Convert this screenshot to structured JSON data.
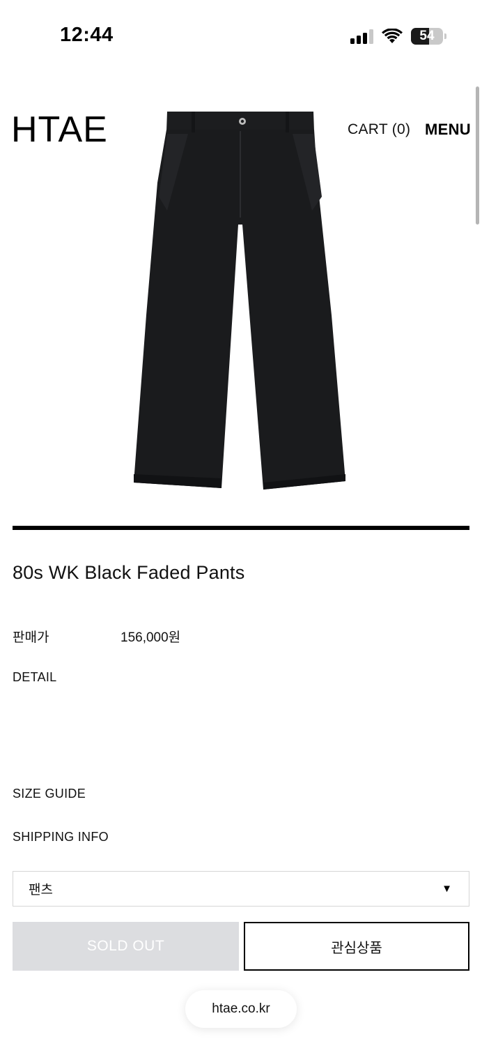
{
  "status_bar": {
    "time": "12:44",
    "battery": "54"
  },
  "header": {
    "logo": "HTAE",
    "cart": "CART (0)",
    "menu": "MENU"
  },
  "product": {
    "image_icon": "black-pants-image",
    "title": "80s WK Black Faded Pants",
    "price_label": "판매가",
    "price_value": "156,000원"
  },
  "links": {
    "detail": "DETAIL",
    "size_guide": "SIZE GUIDE",
    "shipping_info": "SHIPPING INFO"
  },
  "option": {
    "selected": "팬츠"
  },
  "actions": {
    "sold_out": "SOLD OUT",
    "wishlist": "관심상품"
  },
  "browser": {
    "url": "htae.co.kr"
  },
  "colors": {
    "sold_out_bg": "#dcdde0",
    "text": "#111111"
  }
}
